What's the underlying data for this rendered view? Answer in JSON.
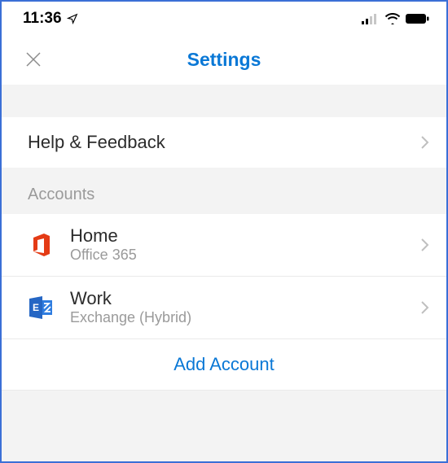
{
  "status": {
    "time": "11:36"
  },
  "header": {
    "title": "Settings"
  },
  "rows": {
    "help": "Help & Feedback"
  },
  "sections": {
    "accounts_label": "Accounts"
  },
  "accounts": [
    {
      "name": "Home",
      "sub": "Office 365",
      "icon": "office-icon"
    },
    {
      "name": "Work",
      "sub": "Exchange (Hybrid)",
      "icon": "exchange-icon"
    }
  ],
  "add_account_label": "Add Account",
  "colors": {
    "accent": "#0a78d6",
    "office_red": "#e43b15",
    "exchange_blue": "#2566c4"
  }
}
